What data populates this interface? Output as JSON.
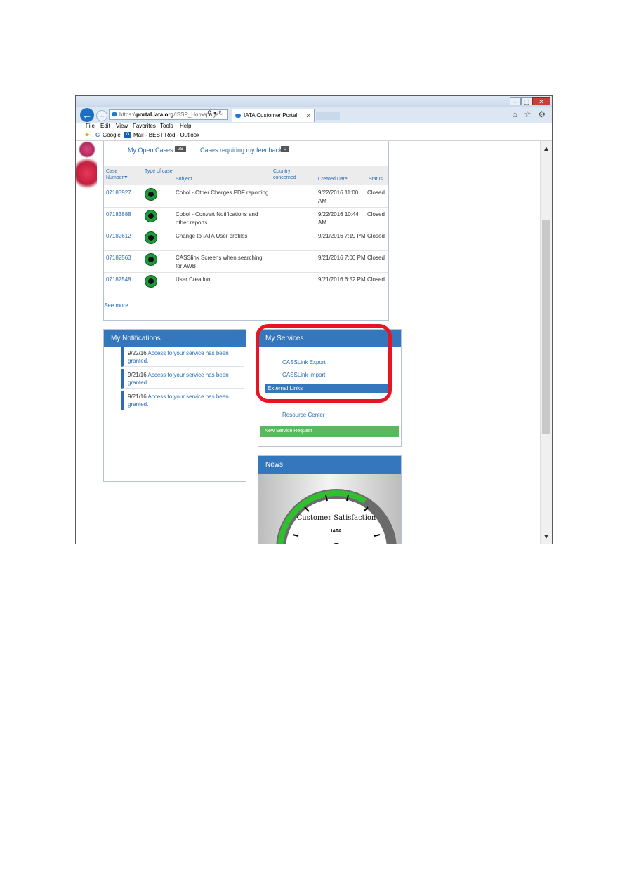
{
  "browser": {
    "title_text": "",
    "window_buttons": {
      "minimize": "–",
      "maximize": "▢",
      "close": "✕"
    },
    "address": {
      "scheme": "https://",
      "domain": "portal.iata.org",
      "path": "/ISSP_Homepage",
      "tools": "⚲ ▾ ↻"
    },
    "tab_title": "IATA Customer Portal",
    "tab_close": "✕",
    "nav_icons": "⌂ ☆ ⚙",
    "menu": [
      "File",
      "Edit",
      "View",
      "Favorites",
      "Tools",
      "Help"
    ],
    "favorites": [
      "Google",
      "Mail - BEST Rod - Outlook"
    ],
    "outlook_icon_label": "O"
  },
  "cases": {
    "open_label": "My Open Cases",
    "open_count": "29",
    "feedback_label": "Cases requiring my feedback",
    "feedback_count": "0",
    "columns": [
      "Case Number▼",
      "Type of case",
      "Subject",
      "Country concerned",
      "Created Date",
      "Status"
    ],
    "rows": [
      {
        "number": "07183927",
        "subject": "Cobol - Other Charges PDF reporting",
        "date": "9/22/2016 11:00 AM",
        "status": "Closed"
      },
      {
        "number": "07183888",
        "subject": "Cobol - Convert Notifications and other reports",
        "date": "9/22/2016 10:44 AM",
        "status": "Closed"
      },
      {
        "number": "07182612",
        "subject": "Change to IATA User profiles",
        "date": "9/21/2016 7:19 PM",
        "status": "Closed"
      },
      {
        "number": "07182563",
        "subject": "CASSlink Screens when searching for AWB",
        "date": "9/21/2016 7:00 PM",
        "status": "Closed"
      },
      {
        "number": "07182548",
        "subject": "User Creation",
        "date": "9/21/2016 6:52 PM",
        "status": "Closed"
      }
    ],
    "see_more": "See more"
  },
  "notifications": {
    "title": "My Notifications",
    "items": [
      {
        "date": "9/22/16",
        "text": "Access to your service has been granted."
      },
      {
        "date": "9/21/16",
        "text": "Access to your service has been granted."
      },
      {
        "date": "9/21/16",
        "text": "Access to your service has been granted."
      }
    ]
  },
  "services": {
    "title": "My Services",
    "links": [
      "CASSLink Export",
      "CASSLink Import"
    ],
    "external_links": "External Links",
    "resource_center": "Resource Center",
    "new_request": "New Service Request"
  },
  "news": {
    "title": "News",
    "gauge_label": "Customer Satisfaction",
    "gauge_logo": "IATA"
  },
  "scroll": {
    "up": "▲",
    "down": "▼"
  },
  "colors": {
    "accent": "#3477bd",
    "link": "#2a6db5",
    "highlight": "#e8141f",
    "button_green": "#5cb85c"
  }
}
